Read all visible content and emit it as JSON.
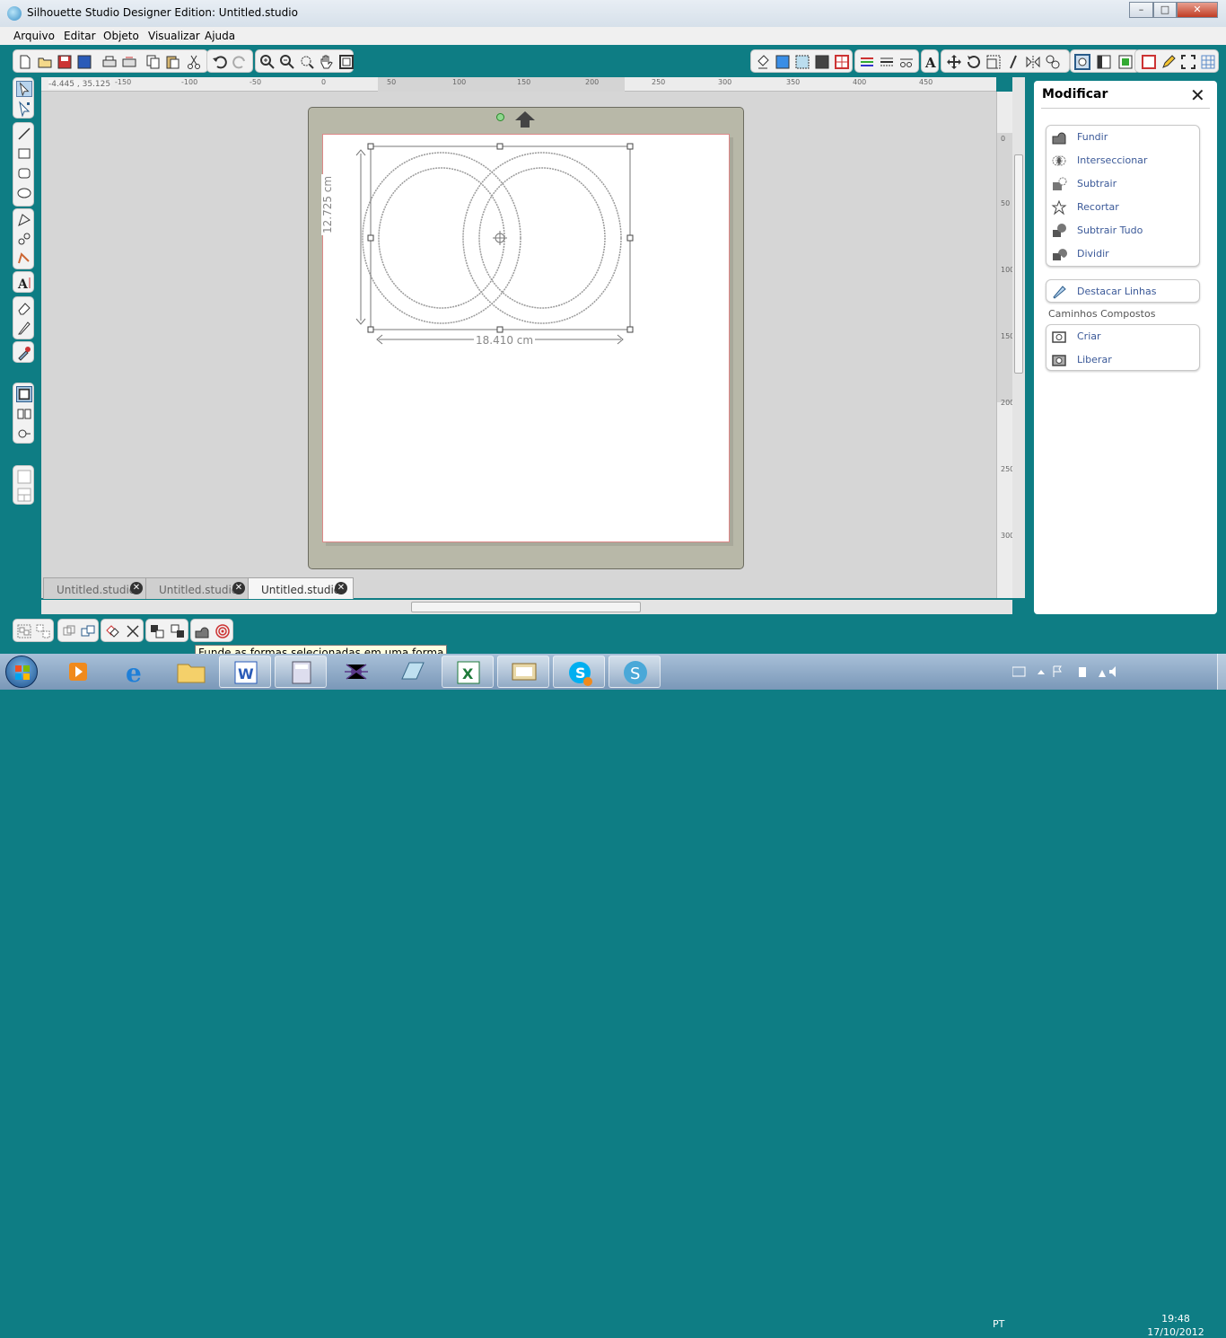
{
  "window": {
    "title": "Silhouette Studio Designer Edition: Untitled.studio",
    "min": "–",
    "max": "□",
    "close": "✕"
  },
  "menu": [
    "Arquivo",
    "Editar",
    "Objeto",
    "Visualizar",
    "Ajuda"
  ],
  "ruler": {
    "coords": "-4.445 , 35.125",
    "h_ticks": [
      "-150",
      "-100",
      "-50",
      "0",
      "50",
      "100",
      "150",
      "200",
      "250",
      "300",
      "350",
      "400",
      "450"
    ],
    "v_ticks": [
      "0",
      "50",
      "100",
      "150",
      "200",
      "250",
      "300"
    ]
  },
  "canvas": {
    "width_label": "18.410 cm",
    "height_label": "12.725 cm"
  },
  "tabs": [
    {
      "label": "Untitled.studio",
      "close": "✕"
    },
    {
      "label": "Untitled.studio",
      "close": "✕"
    },
    {
      "label": "Untitled.studio",
      "close": "✕"
    }
  ],
  "panel": {
    "title": "Modificar",
    "close": "✕",
    "group1": [
      {
        "label": "Fundir",
        "icon": "weld-icon"
      },
      {
        "label": "Interseccionar",
        "icon": "intersect-icon"
      },
      {
        "label": "Subtrair",
        "icon": "subtract-icon"
      },
      {
        "label": "Recortar",
        "icon": "crop-icon"
      },
      {
        "label": "Subtrair Tudo",
        "icon": "subtract-all-icon"
      },
      {
        "label": "Dividir",
        "icon": "divide-icon"
      }
    ],
    "group2": [
      {
        "label": "Destacar Linhas",
        "icon": "release-lines-icon"
      }
    ],
    "section_label": "Caminhos Compostos",
    "group3": [
      {
        "label": "Criar",
        "icon": "make-compound-icon"
      },
      {
        "label": "Liberar",
        "icon": "release-compound-icon"
      }
    ]
  },
  "tooltip": "Funde as formas selecionadas em uma forma",
  "taskbar": {
    "lang": "PT",
    "time": "19:48",
    "date": "17/10/2012"
  },
  "colors": {
    "teal": "#0e7d84",
    "panel_link": "#3b5998",
    "selection": "#888888"
  }
}
